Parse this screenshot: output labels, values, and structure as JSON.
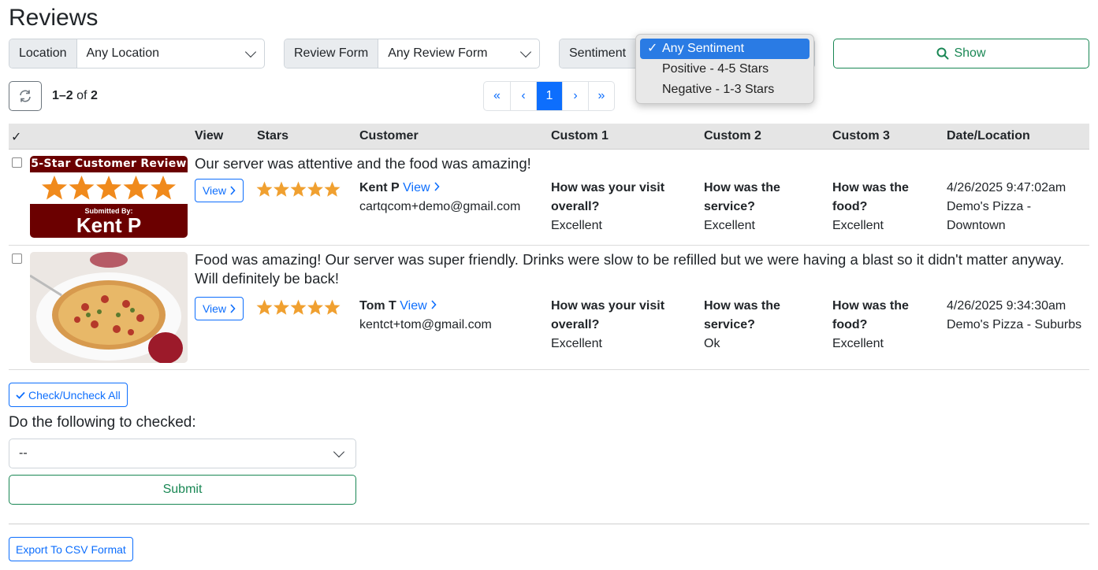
{
  "page": {
    "title": "Reviews"
  },
  "filters": {
    "location": {
      "label": "Location",
      "value": "Any Location"
    },
    "review_form": {
      "label": "Review Form",
      "value": "Any Review Form"
    },
    "sentiment": {
      "label": "Sentiment",
      "options": [
        "Any Sentiment",
        "Positive - 4-5 Stars",
        "Negative - 1-3 Stars"
      ],
      "selected": "Any Sentiment"
    },
    "show_label": "Show"
  },
  "results": {
    "range": "1–2",
    "of": "of",
    "total": "2"
  },
  "pagination": {
    "first": "«",
    "prev": "‹",
    "current": "1",
    "next": "›",
    "last": "»"
  },
  "table": {
    "headers": [
      "✓",
      "View",
      "Stars",
      "Customer",
      "Custom 1",
      "Custom 2",
      "Custom 3",
      "Date/Location"
    ],
    "rows": [
      {
        "text": "Our server was attentive and the food was amazing!",
        "view_label": "View",
        "stars": 5,
        "customer_name": "Kent P",
        "customer_link": "View",
        "customer_email": "cartqcom+demo@gmail.com",
        "custom1_q": "How was your visit overall?",
        "custom1_a": "Excellent",
        "custom2_q": "How was the service?",
        "custom2_a": "Excellent",
        "custom3_q": "How was the food?",
        "custom3_a": "Excellent",
        "date": "4/26/2025 9:47:02am",
        "location": "Demo's Pizza - Downtown",
        "badge": {
          "top": "5-Star Customer Review",
          "sub": "Submitted By:",
          "name": "Kent P"
        }
      },
      {
        "text": "Food was amazing! Our server was super friendly. Drinks were slow to be refilled but we were having a blast so it didn't matter anyway. Will definitely be back!",
        "view_label": "View",
        "stars": 5,
        "customer_name": "Tom T",
        "customer_link": "View",
        "customer_email": "kentct+tom@gmail.com",
        "custom1_q": "How was your visit overall?",
        "custom1_a": "Excellent",
        "custom2_q": "How was the service?",
        "custom2_a": "Ok",
        "custom3_q": "How was the food?",
        "custom3_a": "Excellent",
        "date": "4/26/2025 9:34:30am",
        "location": "Demo's Pizza - Suburbs"
      }
    ]
  },
  "actions": {
    "check_all_label": "Check/Uncheck All",
    "do_label": "Do the following to checked:",
    "action_select_value": "--",
    "submit_label": "Submit",
    "export_label": "Export To CSV Format"
  },
  "colors": {
    "primary": "#0d6efd",
    "success": "#198754",
    "star": "#f0a030",
    "badge_bg": "#6b0000"
  }
}
